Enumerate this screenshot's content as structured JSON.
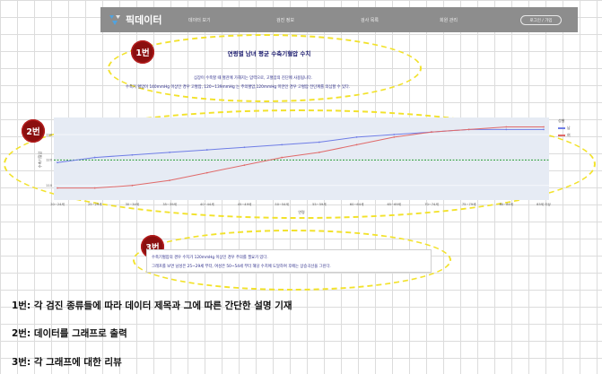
{
  "navbar": {
    "logo": "픽데이터",
    "items": [
      "데이터 보기",
      "검진 정보",
      "검사 목록",
      "회원 관리"
    ],
    "button": "로그인 / 가입"
  },
  "badges": {
    "one": "1번",
    "two": "2번",
    "three": "3번"
  },
  "section1": {
    "title": "연령별 남녀 평균 수축기혈압 수치",
    "lines": [
      "심장이 수축할 때 혈관에 가해지는 압력으로, 고혈압의 진단에 사용됩니다.",
      "수축기 혈압이 140mmHg 이상인 경우 고혈압, 120~139mmHg 는 주의혈압,120mmHg 미만인 경우 고혈압 전단계를 의심할 수 있다."
    ]
  },
  "chart_data": {
    "type": "line",
    "categories": [
      "20~24세",
      "25~29세",
      "30~34세",
      "35~39세",
      "40~44세",
      "45~49세",
      "50~54세",
      "55~59세",
      "60~64세",
      "65~69세",
      "70~74세",
      "75~79세",
      "80~84세",
      "85세 이상"
    ],
    "series": [
      {
        "name": "남",
        "color": "#6f7de6",
        "values": [
          119,
          121,
          122,
          123,
          124,
          125,
          126,
          127,
          129,
          130,
          131,
          132,
          132,
          132
        ]
      },
      {
        "name": "여",
        "color": "#e06a6a",
        "values": [
          109,
          109,
          110,
          112,
          115,
          118,
          121,
          123,
          126,
          129,
          131,
          132,
          133,
          133
        ]
      }
    ],
    "reference": {
      "value": 120,
      "color": "#3aa24a"
    },
    "ylabel": "수축기혈압",
    "xlabel": "연령",
    "yticks": [
      "110",
      "120",
      "130"
    ],
    "ylim": [
      105,
      136
    ],
    "legend_title": "성별",
    "legend_position": "right",
    "grid": true
  },
  "section3": {
    "lines": [
      "수축기혈압의 경우 수치가 120mmHg 이상인 경우 주의를 필요가 있다.",
      "그래프를 보면 남성은 25~29세 부터, 여성은 50~54세 부터 해당 수치에 도달하여 후에는 상승곡선을 그린다."
    ]
  },
  "captions": [
    "1번: 각 검진 종류들에 따라 데이터 제목과 그에 따른 간단한 설명 기재",
    "2번: 데이터를 그래프로 출력",
    "3번: 각 그래프에 대한 리뷰"
  ]
}
